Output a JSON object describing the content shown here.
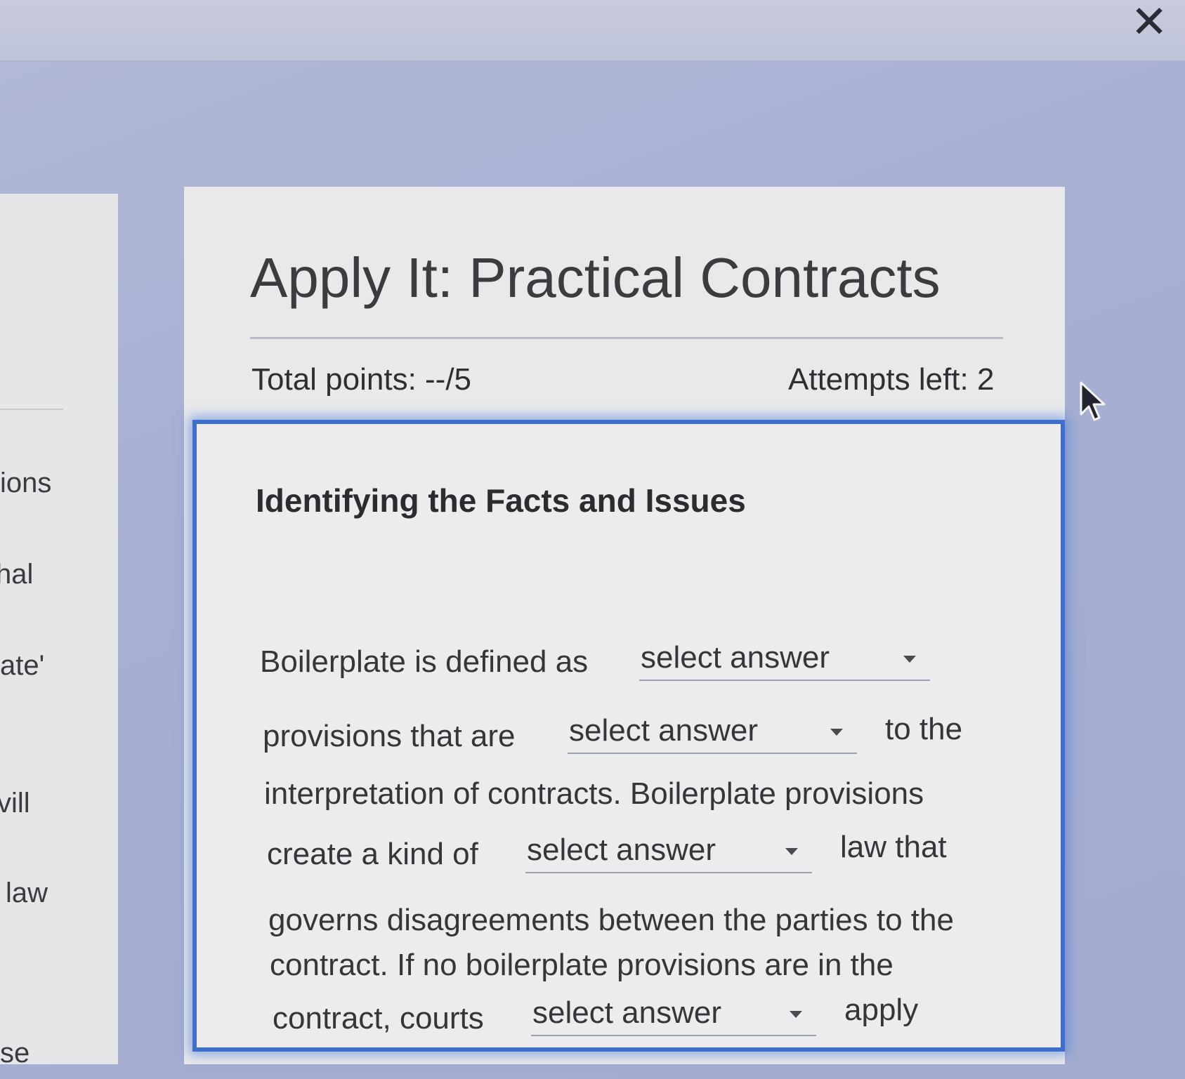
{
  "window": {
    "close_glyph": "✕"
  },
  "sidebar": {
    "fragments": [
      "ions",
      "hal",
      "ate'",
      "vill",
      "law",
      "se"
    ]
  },
  "assignment": {
    "title": "Apply It: Practical Contracts",
    "total_points": "Total points: --/5",
    "attempts_left": "Attempts left: 2"
  },
  "question": {
    "heading": "Identifying the Facts and Issues",
    "segments": [
      "Boilerplate is defined as",
      "provisions that are",
      "to the",
      "interpretation of contracts. Boilerplate provisions",
      "create a kind of",
      "law that",
      "governs disagreements between the parties to the",
      "contract. If no boilerplate provisions are in the",
      "contract, courts",
      "apply"
    ],
    "dropdowns": [
      {
        "value": "select answer"
      },
      {
        "value": "select answer"
      },
      {
        "value": "select answer"
      },
      {
        "value": "select answer"
      }
    ]
  },
  "icons": {
    "close": "close-icon",
    "cursor": "mouse-pointer-icon",
    "dropdown": "chevron-down-icon"
  }
}
